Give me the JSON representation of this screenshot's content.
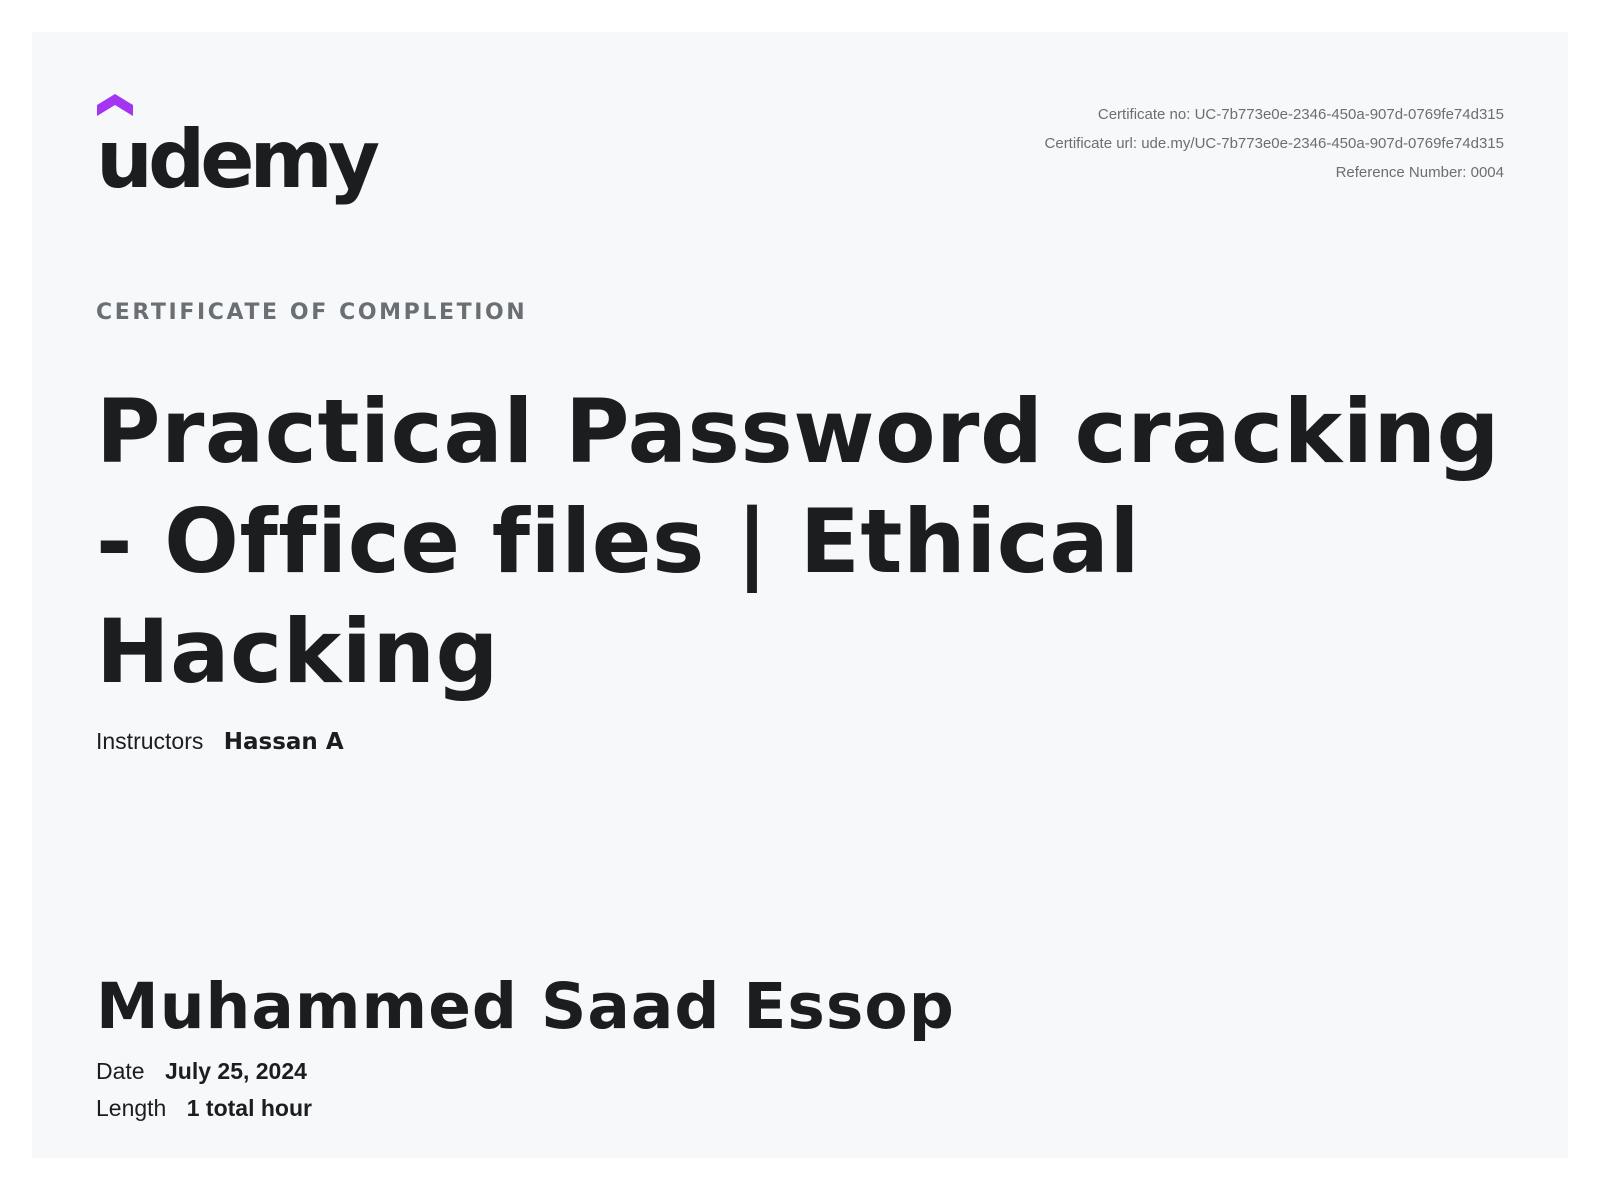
{
  "brand": {
    "name": "udemy",
    "accent_color": "#a435f0",
    "logo_icon": "udemy-hat-icon"
  },
  "certificate": {
    "number_line": "Certificate no: UC-7b773e0e-2346-450a-907d-0769fe74d315",
    "url_line": "Certificate url: ude.my/UC-7b773e0e-2346-450a-907d-0769fe74d315",
    "reference_line": "Reference Number: 0004"
  },
  "heading": "CERTIFICATE OF COMPLETION",
  "course": {
    "title": "Practical Password cracking - Office files | Ethical Hacking"
  },
  "instructors": {
    "label": "Instructors",
    "value": "Hassan A"
  },
  "student": {
    "name": "Muhammed Saad Essop"
  },
  "date": {
    "label": "Date",
    "value": "July 25, 2024"
  },
  "length": {
    "label": "Length",
    "value": "1 total hour"
  }
}
